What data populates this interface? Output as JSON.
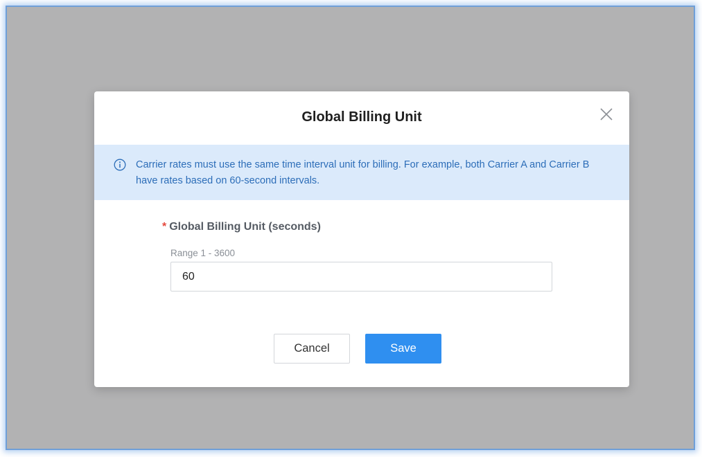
{
  "dialog": {
    "title": "Global Billing Unit",
    "close_icon": "close-icon",
    "info_icon": "info-circle-icon",
    "info_text": "Carrier rates must use the same time interval unit for billing. For example, both Carrier A and Carrier B have rates based on 60-second intervals.",
    "field": {
      "required_mark": "*",
      "label": "Global Billing Unit (seconds)",
      "hint": "Range 1 - 3600",
      "value": "60"
    },
    "buttons": {
      "cancel_label": "Cancel",
      "save_label": "Save"
    }
  },
  "colors": {
    "overlay": "#b2b2b3",
    "banner_bg": "#dbeafb",
    "banner_text": "#2c6db8",
    "primary": "#2f8ff0",
    "required": "#e5483c"
  }
}
